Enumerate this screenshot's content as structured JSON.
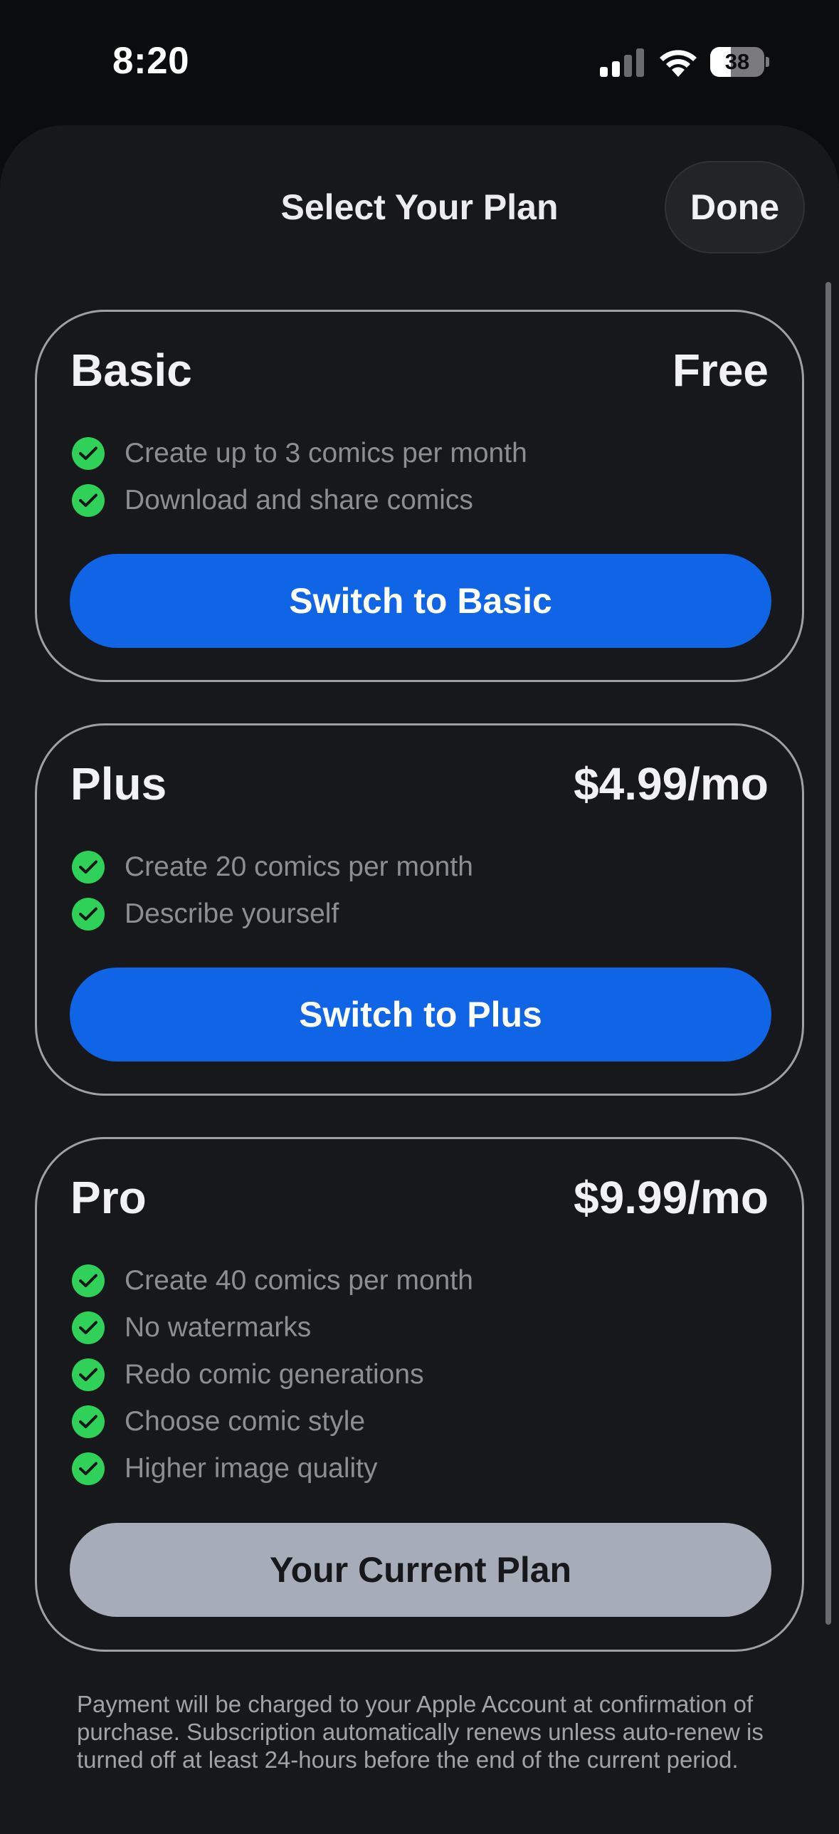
{
  "status_bar": {
    "time": "8:20",
    "battery": "38",
    "battery_level": 0.38
  },
  "sheet": {
    "title": "Select Your Plan",
    "done_label": "Done"
  },
  "plans": [
    {
      "name": "Basic",
      "price": "Free",
      "features": [
        "Create up to 3 comics per month",
        "Download and share comics"
      ],
      "button": "Switch to Basic"
    },
    {
      "name": "Plus",
      "price": "$4.99/mo",
      "features": [
        "Create 20 comics per month",
        "Describe yourself"
      ],
      "button": "Switch to Plus"
    },
    {
      "name": "Pro",
      "price": "$9.99/mo",
      "features": [
        "Create 40 comics per month",
        "No watermarks",
        "Redo comic generations",
        "Choose comic style",
        "Higher image quality"
      ],
      "button": "Your Current Plan"
    }
  ],
  "footnote": "Payment will be charged to your Apple Account at confirmation of purchase. Subscription automatically renews unless auto-renew is turned off at least 24-hours before the end of the current period.",
  "colors": {
    "accent_blue": "#1064e6",
    "check_green": "#30d158",
    "current_plan_gray": "#a6acb8"
  }
}
